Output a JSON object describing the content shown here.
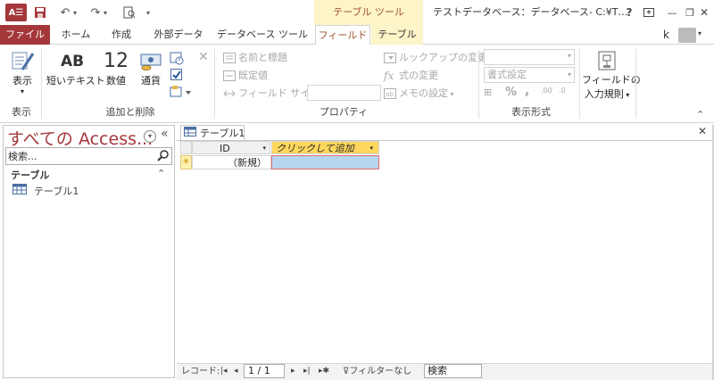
{
  "window": {
    "title": "テストデータベース：データベース- C:¥T…",
    "help_icon": "?",
    "minimize": "—",
    "restore": "❐",
    "close": "✕"
  },
  "app_logo": "A☰",
  "context_tab_header": "テーブル ツール",
  "tabs": {
    "file": "ファイル",
    "home": "ホーム",
    "create": "作成",
    "external": "外部データ",
    "db_tools": "データベース ツール",
    "fields": "フィールド",
    "table": "テーブル"
  },
  "user": {
    "name": "k"
  },
  "ribbon": {
    "view_group": {
      "label": "表示",
      "view_button": "表示"
    },
    "add_delete_group": {
      "label": "追加と削除",
      "short_text": "短いテキスト",
      "short_text_glyph": "AB",
      "number": "数値",
      "number_glyph": "12",
      "currency": "通貨"
    },
    "properties_group": {
      "label": "プロパティ",
      "name_caption": "名前と標題",
      "default_value": "既定値",
      "field_size": "フィールド サイズ",
      "lookup_change": "ルックアップの変更",
      "expression_change": "式の変更",
      "memo_settings": "メモの設定"
    },
    "format_group": {
      "label": "表示形式",
      "format_setting": "書式設定",
      "percent": "%",
      "comma": ",",
      "dec_inc": ".00",
      "dec_dec": ".0"
    },
    "validation_group": {
      "line1": "フィールドの",
      "line2": "入力規則"
    }
  },
  "nav_pane": {
    "title": "すべての Access...",
    "search_placeholder": "検索...",
    "section": "テーブル",
    "items": [
      {
        "label": "テーブル1"
      }
    ]
  },
  "document": {
    "tab_label": "テーブル1",
    "columns": [
      {
        "header": "ID"
      },
      {
        "header": "クリックして追加"
      }
    ],
    "new_row": {
      "marker": "✳",
      "id_value": "（新規）"
    }
  },
  "status_bar": {
    "record_label": "レコード:",
    "position": "1 / 1",
    "filter": "フィルターなし",
    "search": "検索"
  },
  "colors": {
    "brand": "#a4373a",
    "context_tab": "#fdf4c8",
    "add_column_header": "#ffd75e",
    "selected_cell": "#b6d6f0"
  }
}
